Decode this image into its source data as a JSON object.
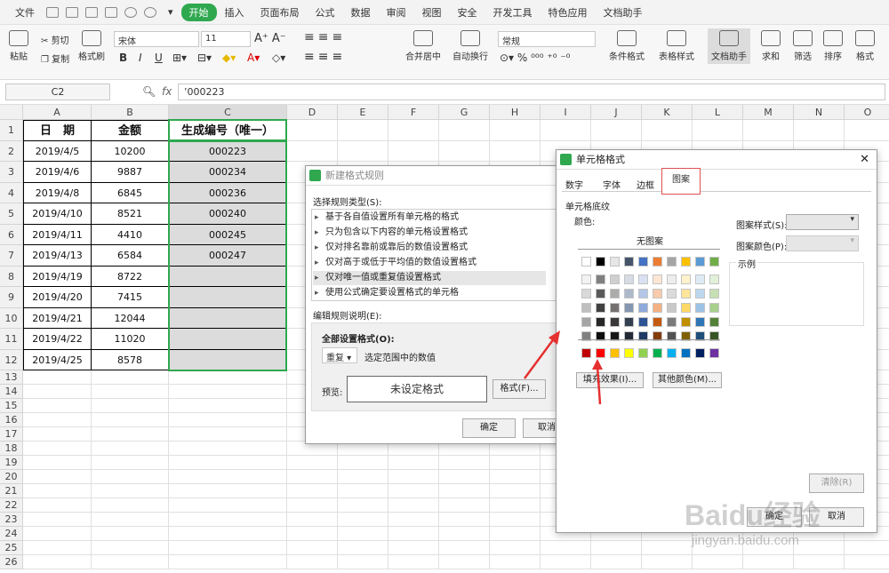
{
  "menu": {
    "items": [
      "文件",
      "开始",
      "插入",
      "页面布局",
      "公式",
      "数据",
      "审阅",
      "视图",
      "安全",
      "开发工具",
      "特色应用",
      "文档助手"
    ],
    "active_index": 1,
    "accent": "#2fa84f"
  },
  "ribbon": {
    "paste": "粘贴",
    "cut": "剪切",
    "copy": "复制",
    "format_painter": "格式刷",
    "font_name": "宋体",
    "font_size": "11",
    "bold": "B",
    "italic": "I",
    "underline": "U",
    "merge_center": "合并居中",
    "wrap_text": "自动换行",
    "number_format": "常规",
    "cond_format": "条件格式",
    "table_style": "表格样式",
    "doc_assistant": "文档助手",
    "sum": "求和",
    "filter": "筛选",
    "sort": "排序",
    "format": "格式"
  },
  "formula_bar": {
    "cell_ref": "C2",
    "fx": "fx",
    "content": "’000223"
  },
  "sheet": {
    "columns": [
      "A",
      "B",
      "C",
      "D",
      "E",
      "F",
      "G",
      "H",
      "I",
      "J",
      "K",
      "L",
      "M",
      "N",
      "O"
    ],
    "rows": [
      "1",
      "2",
      "3",
      "4",
      "5",
      "6",
      "7",
      "8",
      "9",
      "10",
      "11",
      "12",
      "13",
      "14",
      "15",
      "16",
      "17",
      "18",
      "19",
      "20",
      "21",
      "22",
      "23",
      "24",
      "25",
      "26"
    ],
    "headers": [
      "日　期",
      "金额",
      "生成编号（唯一）"
    ],
    "data": [
      [
        "2019/4/5",
        "10200",
        "000223"
      ],
      [
        "2019/4/6",
        "9887",
        "000234"
      ],
      [
        "2019/4/8",
        "6845",
        "000236"
      ],
      [
        "2019/4/10",
        "8521",
        "000240"
      ],
      [
        "2019/4/11",
        "4410",
        "000245"
      ],
      [
        "2019/4/13",
        "6584",
        "000247"
      ],
      [
        "2019/4/19",
        "8722",
        ""
      ],
      [
        "2019/4/20",
        "7415",
        ""
      ],
      [
        "2019/4/21",
        "12044",
        ""
      ],
      [
        "2019/4/22",
        "11020",
        ""
      ],
      [
        "2019/4/25",
        "8578",
        ""
      ]
    ]
  },
  "rule_dialog": {
    "title": "新建格式规则",
    "select_type_label": "选择规则类型(S):",
    "rules": [
      "基于各自值设置所有单元格的格式",
      "只为包含以下内容的单元格设置格式",
      "仅对排名靠前或靠后的数值设置格式",
      "仅对高于或低于平均值的数值设置格式",
      "仅对唯一值或重复值设置格式",
      "使用公式确定要设置格式的单元格"
    ],
    "selected_index": 4,
    "edit_desc_label": "编辑规则说明(E):",
    "format_all_label": "全部设置格式(O):",
    "dup_value": "重复",
    "dup_desc": "选定范围中的数值",
    "preview_label": "预览:",
    "preview_text": "未设定格式",
    "format_button": "格式(F)...",
    "ok": "确定",
    "cancel": "取消"
  },
  "cell_dialog": {
    "title": "单元格格式",
    "tabs": [
      "数字",
      "字体",
      "边框",
      "图案"
    ],
    "active_tab": 3,
    "section": "单元格底纹",
    "color_label": "颜色:",
    "no_pattern": "无图案",
    "pattern_style_label": "图案样式(S):",
    "pattern_color_label": "图案颜色(P):",
    "sample_label": "示例",
    "fill_effects": "填充效果(I)...",
    "more_colors": "其他颜色(M)...",
    "clear": "清除(R)",
    "ok": "确定",
    "cancel": "取消"
  },
  "palette": {
    "theme_top": [
      "#ffffff",
      "#000000",
      "#e7e6e6",
      "#44546a",
      "#4472c4",
      "#ed7d31",
      "#a5a5a5",
      "#ffc000",
      "#5b9bd5",
      "#70ad47"
    ],
    "theme_rows": [
      [
        "#f2f2f2",
        "#808080",
        "#d0cece",
        "#d6dce4",
        "#d9e2f3",
        "#fbe5d5",
        "#ededed",
        "#fff2cc",
        "#deebf6",
        "#e2efd9"
      ],
      [
        "#d9d9d9",
        "#595959",
        "#aeabab",
        "#adb9ca",
        "#b4c6e7",
        "#f7cbac",
        "#dbdbdb",
        "#fee599",
        "#bdd7ee",
        "#c5e0b3"
      ],
      [
        "#bfbfbf",
        "#404040",
        "#757070",
        "#8496b0",
        "#8eaadb",
        "#f4b183",
        "#c9c9c9",
        "#ffd965",
        "#9cc3e5",
        "#a8d08d"
      ],
      [
        "#a6a6a6",
        "#262626",
        "#3a3838",
        "#323f4f",
        "#2f5496",
        "#c55a11",
        "#7b7b7b",
        "#bf8f00",
        "#2e75b5",
        "#538135"
      ],
      [
        "#808080",
        "#0d0d0d",
        "#171616",
        "#222a35",
        "#1f3864",
        "#833c0b",
        "#525252",
        "#7f6000",
        "#1e4e79",
        "#375623"
      ]
    ],
    "standard": [
      "#c00000",
      "#ff0000",
      "#ffc000",
      "#ffff00",
      "#92d050",
      "#00b050",
      "#00b0f0",
      "#0070c0",
      "#002060",
      "#7030a0"
    ]
  },
  "watermark": {
    "brand": "Baidu经验",
    "url": "jingyan.baidu.com"
  }
}
